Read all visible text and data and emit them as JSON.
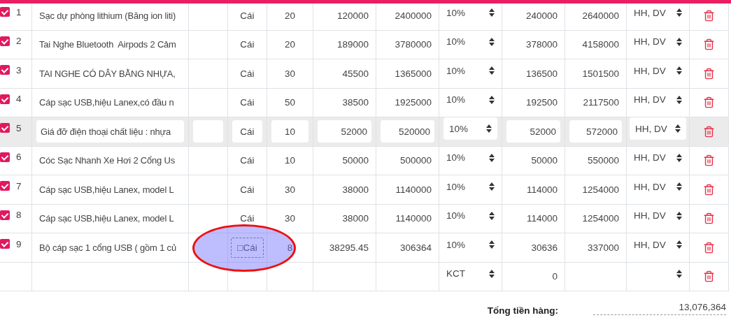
{
  "rows": [
    {
      "kind": "item",
      "checked": true,
      "editing": false,
      "unit_focused": false,
      "no": "1",
      "name": "Sạc dự phòng lithium (Băng ion liti)",
      "unit": "Cái",
      "qty": "20",
      "price": "120000",
      "amount": "2400000",
      "vat": "10%",
      "vat_amount": "240000",
      "total": "2640000",
      "type": "HH, DV"
    },
    {
      "kind": "item",
      "checked": true,
      "editing": false,
      "unit_focused": false,
      "no": "2",
      "name": "Tai Nghe Bluetooth  Airpods 2 Cảm",
      "unit": "Cái",
      "qty": "20",
      "price": "189000",
      "amount": "3780000",
      "vat": "10%",
      "vat_amount": "378000",
      "total": "4158000",
      "type": "HH, DV"
    },
    {
      "kind": "item",
      "checked": true,
      "editing": false,
      "unit_focused": false,
      "no": "3",
      "name": "TAI NGHE CÓ DÂY BẰNG NHỰA,",
      "unit": "Cái",
      "qty": "30",
      "price": "45500",
      "amount": "1365000",
      "vat": "10%",
      "vat_amount": "136500",
      "total": "1501500",
      "type": "HH, DV"
    },
    {
      "kind": "item",
      "checked": true,
      "editing": false,
      "unit_focused": false,
      "no": "4",
      "name": "Cáp sạc USB,hiệu Lanex,có đầu n",
      "unit": "Cái",
      "qty": "50",
      "price": "38500",
      "amount": "1925000",
      "vat": "10%",
      "vat_amount": "192500",
      "total": "2117500",
      "type": "HH, DV"
    },
    {
      "kind": "item",
      "checked": true,
      "editing": true,
      "unit_focused": false,
      "no": "5",
      "name": "Giá đỡ điện thoại chất liệu : nhựa",
      "unit": "Cái",
      "qty": "10",
      "price": "52000",
      "amount": "520000",
      "vat": "10%",
      "vat_amount": "52000",
      "total": "572000",
      "type": "HH, DV"
    },
    {
      "kind": "item",
      "checked": true,
      "editing": false,
      "unit_focused": false,
      "no": "6",
      "name": "Cóc Sạc Nhanh Xe Hơi 2 Cổng Us",
      "unit": "Cái",
      "qty": "10",
      "price": "50000",
      "amount": "500000",
      "vat": "10%",
      "vat_amount": "50000",
      "total": "550000",
      "type": "HH, DV"
    },
    {
      "kind": "item",
      "checked": true,
      "editing": false,
      "unit_focused": false,
      "no": "7",
      "name": "Cáp sạc USB,hiệu Lanex, model L",
      "unit": "Cái",
      "qty": "30",
      "price": "38000",
      "amount": "1140000",
      "vat": "10%",
      "vat_amount": "114000",
      "total": "1254000",
      "type": "HH, DV"
    },
    {
      "kind": "item",
      "checked": true,
      "editing": false,
      "unit_focused": false,
      "no": "8",
      "name": "Cáp sạc USB,hiệu Lanex, model L",
      "unit": "Cái",
      "qty": "30",
      "price": "38000",
      "amount": "1140000",
      "vat": "10%",
      "vat_amount": "114000",
      "total": "1254000",
      "type": "HH, DV"
    },
    {
      "kind": "item",
      "checked": true,
      "editing": false,
      "unit_focused": true,
      "no": "9",
      "name": "Bộ cáp sạc 1 cổng USB ( gồm 1 củ",
      "unit": "□Cái",
      "qty": "8",
      "price": "38295.45",
      "amount": "306364",
      "vat": "10%",
      "vat_amount": "30636",
      "total": "337000",
      "type": "HH, DV"
    },
    {
      "kind": "blank",
      "editing": false,
      "unit_focused": false,
      "vat": "KCT",
      "vat_amount": "0"
    }
  ],
  "summary": {
    "label": "Tổng tiền hàng:",
    "value": "13,076,364"
  }
}
